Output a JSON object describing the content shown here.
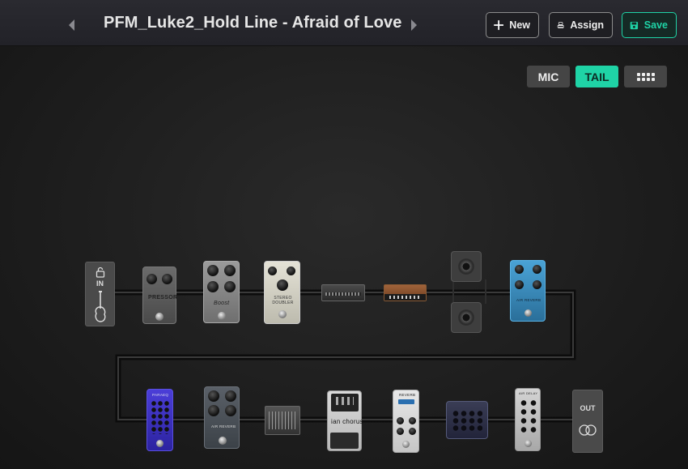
{
  "header": {
    "preset_title": "PFM_Luke2_Hold Line - Afraid of Love",
    "new_label": "New",
    "assign_label": "Assign",
    "save_label": "Save"
  },
  "view_toggle": {
    "mic_label": "MIC",
    "tail_label": "TAIL",
    "active": "TAIL",
    "accent": "#1fd3a6"
  },
  "signal_chain": {
    "input_label": "IN",
    "output_label": "OUT",
    "row1": [
      {
        "name": "compressor",
        "label": "PRESSOR"
      },
      {
        "name": "boost",
        "label": "Boost"
      },
      {
        "name": "stereo-doubler",
        "label": "STEREO DOUBLER"
      },
      {
        "name": "amp-1",
        "label": ""
      },
      {
        "name": "amp-2",
        "label": ""
      },
      {
        "name": "cab-1",
        "label": ""
      },
      {
        "name": "cab-2",
        "label": ""
      },
      {
        "name": "blue-reverb",
        "label": "AIR REVERB"
      }
    ],
    "row2": [
      {
        "name": "parametric-eq",
        "label": "PARAEQ"
      },
      {
        "name": "grey-reverb",
        "label": "AIR REVERB"
      },
      {
        "name": "graphic-eq",
        "label": ""
      },
      {
        "name": "chorus",
        "label": "ian chorus"
      },
      {
        "name": "reverb",
        "label": "REVERB"
      },
      {
        "name": "rack-delay",
        "label": ""
      },
      {
        "name": "delay",
        "label": "AIR DELAY"
      }
    ]
  }
}
